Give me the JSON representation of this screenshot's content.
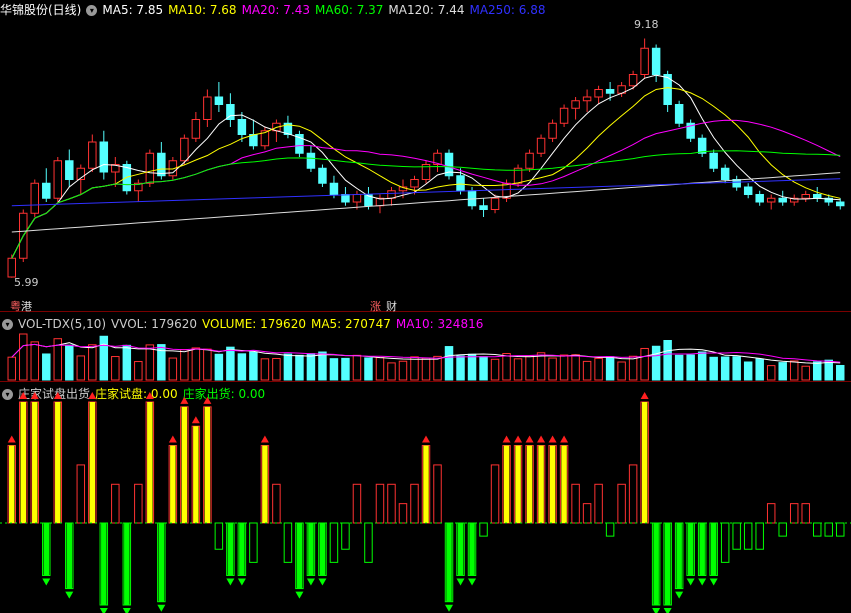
{
  "main": {
    "stock_label": "华锦股份(日线)",
    "ma_labels": [
      {
        "text": "MA5: 7.85",
        "color": "#ffffff"
      },
      {
        "text": "MA10: 7.68",
        "color": "#ffff00"
      },
      {
        "text": "MA20: 7.43",
        "color": "#ff00ff"
      },
      {
        "text": "MA60: 7.37",
        "color": "#00ff00"
      },
      {
        "text": "MA120: 7.44",
        "color": "#dddddd"
      },
      {
        "text": "MA250: 6.88",
        "color": "#3030ff"
      }
    ],
    "high_label": "9.18",
    "low_label": "5.99",
    "event_labels": {
      "left": "港",
      "left_prefix": "粤",
      "mid_a": "涨",
      "mid_b": "财"
    }
  },
  "volume": {
    "title": "VOL-TDX(5,10)",
    "labels": [
      {
        "text": "VVOL: 179620",
        "color": "#cccccc"
      },
      {
        "text": "VOLUME: 179620",
        "color": "#ffff00"
      },
      {
        "text": "MA5: 270747",
        "color": "#ffff00"
      },
      {
        "text": "MA10: 324816",
        "color": "#ff00ff"
      }
    ]
  },
  "indicator": {
    "title": "庄家试盘出货",
    "labels": [
      {
        "text": "庄家试盘: 0.00",
        "color": "#ffff00"
      },
      {
        "text": "庄家出货: 0.00",
        "color": "#00ff00"
      }
    ]
  },
  "chart_data": {
    "type": "candlestick",
    "up_color": "#ff3232",
    "down_color": "#54ffff",
    "price_ylim": [
      5.8,
      9.4
    ],
    "price_annotations": {
      "max": 9.18,
      "min": 5.99
    },
    "candles_ohlc": [
      [
        6.0,
        6.3,
        5.99,
        6.25
      ],
      [
        6.25,
        6.9,
        6.2,
        6.85
      ],
      [
        6.85,
        7.3,
        6.8,
        7.25
      ],
      [
        7.25,
        7.45,
        7.0,
        7.05
      ],
      [
        7.05,
        7.6,
        7.0,
        7.55
      ],
      [
        7.55,
        7.7,
        7.2,
        7.3
      ],
      [
        7.3,
        7.5,
        7.1,
        7.45
      ],
      [
        7.45,
        7.9,
        7.4,
        7.8
      ],
      [
        7.8,
        7.95,
        7.3,
        7.4
      ],
      [
        7.4,
        7.6,
        7.2,
        7.5
      ],
      [
        7.5,
        7.55,
        7.1,
        7.15
      ],
      [
        7.15,
        7.3,
        7.0,
        7.25
      ],
      [
        7.25,
        7.7,
        7.2,
        7.65
      ],
      [
        7.65,
        7.8,
        7.3,
        7.35
      ],
      [
        7.35,
        7.6,
        7.3,
        7.55
      ],
      [
        7.55,
        7.9,
        7.5,
        7.85
      ],
      [
        7.85,
        8.2,
        7.8,
        8.1
      ],
      [
        8.1,
        8.5,
        8.0,
        8.4
      ],
      [
        8.4,
        8.6,
        8.2,
        8.3
      ],
      [
        8.3,
        8.45,
        8.0,
        8.1
      ],
      [
        8.1,
        8.2,
        7.8,
        7.9
      ],
      [
        7.9,
        8.1,
        7.7,
        7.75
      ],
      [
        7.75,
        8.0,
        7.7,
        7.95
      ],
      [
        7.95,
        8.1,
        7.8,
        8.05
      ],
      [
        8.05,
        8.15,
        7.85,
        7.9
      ],
      [
        7.9,
        7.95,
        7.6,
        7.65
      ],
      [
        7.65,
        7.75,
        7.4,
        7.45
      ],
      [
        7.45,
        7.5,
        7.2,
        7.25
      ],
      [
        7.25,
        7.35,
        7.05,
        7.1
      ],
      [
        7.1,
        7.2,
        6.95,
        7.0
      ],
      [
        7.0,
        7.15,
        6.9,
        7.1
      ],
      [
        7.1,
        7.2,
        6.9,
        6.95
      ],
      [
        6.95,
        7.1,
        6.85,
        7.05
      ],
      [
        7.05,
        7.2,
        6.95,
        7.15
      ],
      [
        7.15,
        7.3,
        7.05,
        7.2
      ],
      [
        7.2,
        7.35,
        7.1,
        7.3
      ],
      [
        7.3,
        7.55,
        7.25,
        7.5
      ],
      [
        7.5,
        7.7,
        7.4,
        7.65
      ],
      [
        7.65,
        7.7,
        7.3,
        7.35
      ],
      [
        7.35,
        7.45,
        7.1,
        7.15
      ],
      [
        7.15,
        7.2,
        6.9,
        6.95
      ],
      [
        6.95,
        7.05,
        6.8,
        6.9
      ],
      [
        6.9,
        7.1,
        6.85,
        7.05
      ],
      [
        7.05,
        7.3,
        7.0,
        7.25
      ],
      [
        7.25,
        7.5,
        7.2,
        7.45
      ],
      [
        7.45,
        7.7,
        7.4,
        7.65
      ],
      [
        7.65,
        7.9,
        7.6,
        7.85
      ],
      [
        7.85,
        8.1,
        7.8,
        8.05
      ],
      [
        8.05,
        8.3,
        8.0,
        8.25
      ],
      [
        8.25,
        8.4,
        8.1,
        8.35
      ],
      [
        8.35,
        8.5,
        8.2,
        8.4
      ],
      [
        8.4,
        8.55,
        8.3,
        8.5
      ],
      [
        8.5,
        8.6,
        8.35,
        8.45
      ],
      [
        8.45,
        8.6,
        8.4,
        8.55
      ],
      [
        8.55,
        8.75,
        8.5,
        8.7
      ],
      [
        8.7,
        9.18,
        8.65,
        9.05
      ],
      [
        9.05,
        9.1,
        8.6,
        8.7
      ],
      [
        8.7,
        8.75,
        8.2,
        8.3
      ],
      [
        8.3,
        8.35,
        8.0,
        8.05
      ],
      [
        8.05,
        8.1,
        7.8,
        7.85
      ],
      [
        7.85,
        7.9,
        7.6,
        7.65
      ],
      [
        7.65,
        7.7,
        7.4,
        7.45
      ],
      [
        7.45,
        7.5,
        7.25,
        7.3
      ],
      [
        7.3,
        7.35,
        7.15,
        7.2
      ],
      [
        7.2,
        7.25,
        7.05,
        7.1
      ],
      [
        7.1,
        7.15,
        6.95,
        7.0
      ],
      [
        7.0,
        7.1,
        6.9,
        7.05
      ],
      [
        7.05,
        7.15,
        6.95,
        7.0
      ],
      [
        7.0,
        7.1,
        6.95,
        7.05
      ],
      [
        7.05,
        7.15,
        7.0,
        7.1
      ],
      [
        7.1,
        7.2,
        7.0,
        7.05
      ],
      [
        7.05,
        7.1,
        6.95,
        7.0
      ],
      [
        7.0,
        7.05,
        6.9,
        6.95
      ]
    ],
    "volume_series": [
      {
        "name": "MA5",
        "color": "#ffff00",
        "value": 270747
      },
      {
        "name": "MA10",
        "color": "#ff00ff",
        "value": 324816
      },
      {
        "name": "VOLUME",
        "color": "#ffff00",
        "value": 179620
      }
    ],
    "indicator_series": [
      {
        "name": "庄家试盘",
        "color": "#ffff00",
        "value": 0.0
      },
      {
        "name": "庄家出货",
        "color": "#00ff00",
        "value": 0.0
      }
    ]
  }
}
